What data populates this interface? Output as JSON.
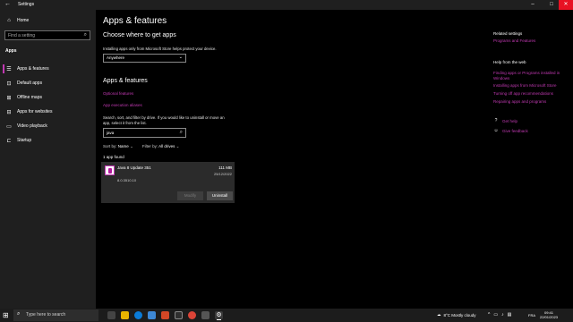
{
  "window": {
    "title": "Settings",
    "back_glyph": "←",
    "minimize_glyph": "–",
    "maximize_glyph": "□",
    "close_glyph": "✕"
  },
  "sidebar": {
    "home_label": "Home",
    "search_placeholder": "Find a setting",
    "section_label": "Apps",
    "items": [
      {
        "label": "Apps & features",
        "icon": "apps-features-icon",
        "glyph": "☰",
        "active": true
      },
      {
        "label": "Default apps",
        "icon": "default-apps-icon",
        "glyph": "⊡",
        "active": false
      },
      {
        "label": "Offline maps",
        "icon": "offline-maps-icon",
        "glyph": "⊞",
        "active": false
      },
      {
        "label": "Apps for websites",
        "icon": "apps-websites-icon",
        "glyph": "⊟",
        "active": false
      },
      {
        "label": "Video playback",
        "icon": "video-playback-icon",
        "glyph": "▭",
        "active": false
      },
      {
        "label": "Startup",
        "icon": "startup-icon",
        "glyph": "⊏",
        "active": false
      }
    ]
  },
  "main": {
    "title": "Apps & features",
    "choose_heading": "Choose where to get apps",
    "choose_desc": "Installing apps only from Microsoft Store helps protect your device.",
    "source_dropdown": "Anywhere",
    "apps_heading": "Apps & features",
    "link_optional": "Optional features",
    "link_aliases": "App execution aliases",
    "search_desc_1": "Search, sort, and filter by drive. If you would like to uninstall or move an",
    "search_desc_2": "app, select it from the list.",
    "search_value": "java",
    "sort_label": "Sort by:",
    "sort_value": "Name",
    "filter_label": "Filter by:",
    "filter_value": "All drives",
    "found_text": "1 app found",
    "app": {
      "name": "Java 8 Update 351",
      "size": "111 MB",
      "date": "25/12/2022",
      "version": "8.0.3510.10",
      "modify_label": "Modify",
      "uninstall_label": "Uninstall"
    }
  },
  "related": {
    "heading": "Related settings",
    "link_programs": "Programs and Features",
    "web_heading": "Help from the web",
    "web_links": [
      "Finding apps or Programs installed in",
      "Windows",
      "Installing apps from Microsoft Store",
      "Turning off app recommendations",
      "Repairing apps and programs"
    ],
    "get_help": "Get help",
    "give_feedback": "Give feedback"
  },
  "taskbar": {
    "search_placeholder": "Type here to search",
    "weather": "8°C  Mostly cloudy",
    "language": "FRA",
    "time": "09:41",
    "date": "22/01/2023",
    "accent": "#c239b3"
  }
}
